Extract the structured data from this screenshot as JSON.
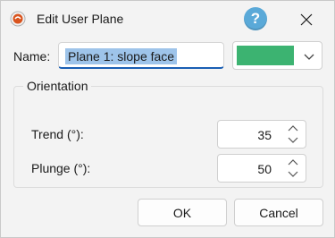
{
  "window": {
    "title": "Edit User Plane",
    "app_icon": "orange-circle-app-icon",
    "help_icon": "question-mark-icon",
    "close_icon": "close-x-icon"
  },
  "name_row": {
    "label": "Name:",
    "value": "Plane 1: slope face",
    "color_swatch": "#3cb371",
    "dropdown_icon": "chevron-down-icon"
  },
  "orientation": {
    "group_label": "Orientation",
    "trend": {
      "label": "Trend (°):",
      "value": "35"
    },
    "plunge": {
      "label": "Plunge (°):",
      "value": "50"
    },
    "spinner_icon": "up-down-arrows-icon"
  },
  "buttons": {
    "ok_label": "OK",
    "cancel_label": "Cancel"
  },
  "colors": {
    "accent": "#1a5fb4",
    "selection": "#9ec4ea",
    "help": "#5aa9d8"
  }
}
